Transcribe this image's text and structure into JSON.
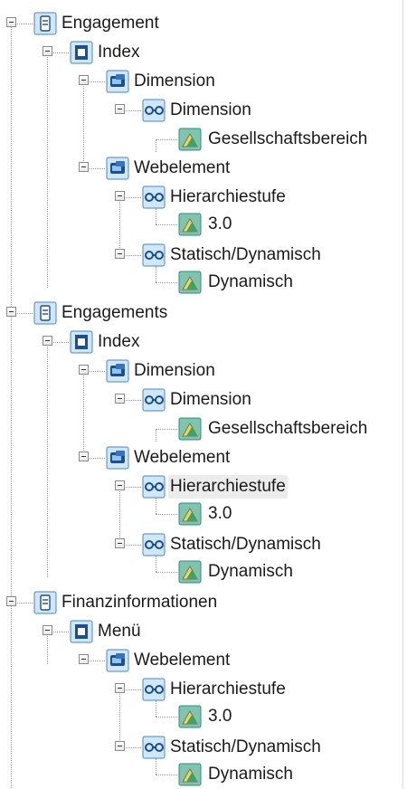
{
  "tree": {
    "nodes": [
      {
        "label": "Engagement",
        "icon": "database-icon"
      },
      {
        "label": "Index",
        "icon": "index-icon"
      },
      {
        "label": "Dimension",
        "icon": "dimension-group-icon"
      },
      {
        "label": "Dimension",
        "icon": "key-icon"
      },
      {
        "label": "Gesellschaftsbereich",
        "icon": "value-icon"
      },
      {
        "label": "Webelement",
        "icon": "dimension-group-icon"
      },
      {
        "label": "Hierarchiestufe",
        "icon": "key-icon"
      },
      {
        "label": "3.0",
        "icon": "value-icon"
      },
      {
        "label": "Statisch/Dynamisch",
        "icon": "key-icon"
      },
      {
        "label": "Dynamisch",
        "icon": "value-icon"
      },
      {
        "label": "Engagements",
        "icon": "database-icon"
      },
      {
        "label": "Index",
        "icon": "index-icon"
      },
      {
        "label": "Dimension",
        "icon": "dimension-group-icon"
      },
      {
        "label": "Dimension",
        "icon": "key-icon"
      },
      {
        "label": "Gesellschaftsbereich",
        "icon": "value-icon"
      },
      {
        "label": "Webelement",
        "icon": "dimension-group-icon"
      },
      {
        "label": "Hierarchiestufe",
        "icon": "key-icon"
      },
      {
        "label": "3.0",
        "icon": "value-icon"
      },
      {
        "label": "Statisch/Dynamisch",
        "icon": "key-icon"
      },
      {
        "label": "Dynamisch",
        "icon": "value-icon"
      },
      {
        "label": "Finanzinformationen",
        "icon": "database-icon"
      },
      {
        "label": "Menü",
        "icon": "index-icon"
      },
      {
        "label": "Webelement",
        "icon": "dimension-group-icon"
      },
      {
        "label": "Hierarchiestufe",
        "icon": "key-icon"
      },
      {
        "label": "3.0",
        "icon": "value-icon"
      },
      {
        "label": "Statisch/Dynamisch",
        "icon": "key-icon"
      },
      {
        "label": "Dynamisch",
        "icon": "value-icon"
      }
    ]
  }
}
